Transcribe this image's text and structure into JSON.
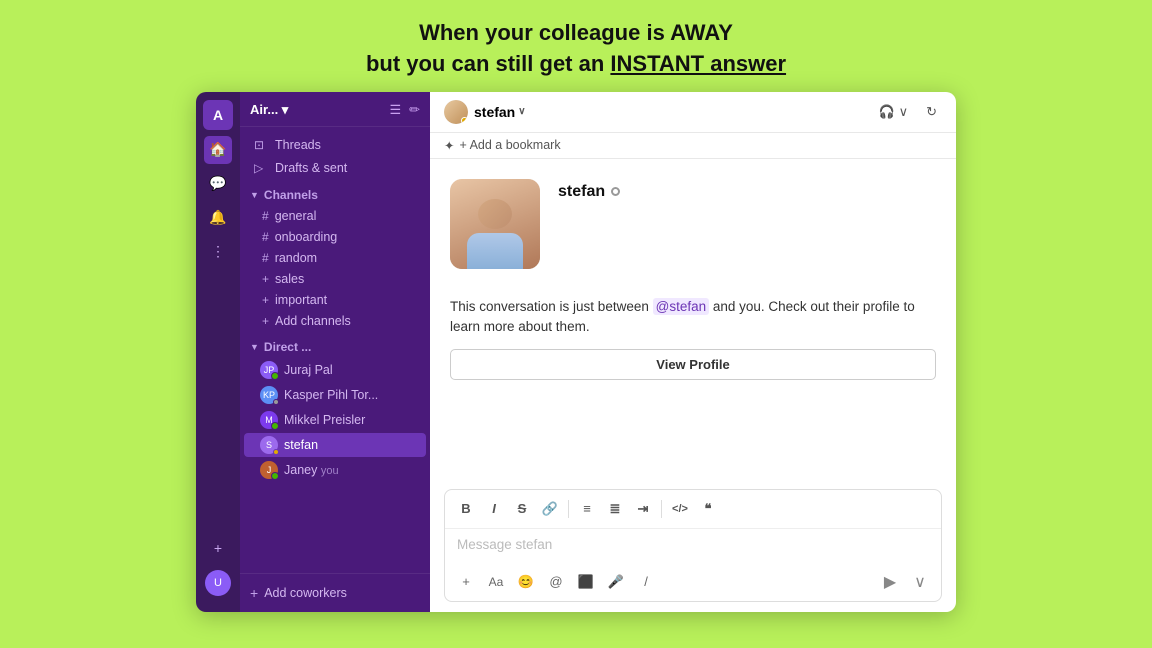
{
  "headline": {
    "line1": "When your colleague is AWAY",
    "line2": "but you can still get an ",
    "line2_highlight": "INSTANT answer"
  },
  "app": {
    "workspace": "Air... ▾",
    "logo_letter": "A"
  },
  "sidebar": {
    "nav_items": [
      {
        "id": "threads",
        "label": "Threads",
        "icon": "⊡"
      },
      {
        "id": "drafts",
        "label": "Drafts & sent",
        "icon": "▷"
      }
    ],
    "channels_label": "Channels",
    "channels": [
      {
        "id": "general",
        "name": "general"
      },
      {
        "id": "onboarding",
        "name": "onboarding"
      },
      {
        "id": "random",
        "name": "random"
      },
      {
        "id": "sales",
        "name": "sales",
        "plus": true
      },
      {
        "id": "important",
        "name": "important",
        "plus": true
      },
      {
        "id": "add",
        "name": "Add channels",
        "is_add": true
      }
    ],
    "direct_label": "Direct ...",
    "dms": [
      {
        "id": "juraj",
        "name": "Juraj Pal",
        "color": "#8b5cf6",
        "initials": "JP",
        "status": "online"
      },
      {
        "id": "kasper",
        "name": "Kasper Pihl Tor...",
        "color": "#5c8ff5",
        "initials": "KP",
        "status": "away"
      },
      {
        "id": "mikkel",
        "name": "Mikkel Preisler",
        "color": "#7c3aed",
        "initials": "MP",
        "status": "online"
      },
      {
        "id": "stefan",
        "name": "stefan",
        "color": "#9c6aed",
        "initials": "S",
        "status": "away",
        "active": true
      },
      {
        "id": "janey",
        "name": "Janey",
        "you": true,
        "color": "#c06030",
        "initials": "J",
        "status": "online"
      }
    ],
    "add_coworkers": "Add coworkers"
  },
  "main": {
    "header": {
      "name": "stefan",
      "chevron": "∨",
      "bookmark_label": "+ Add a bookmark"
    },
    "profile": {
      "name": "stefan",
      "intro_text_pre": "This conversation is just between ",
      "mention": "@stefan",
      "intro_text_post": " and you. Check out their profile to learn more about them.",
      "view_profile_btn": "View Profile"
    },
    "composer": {
      "placeholder": "Message stefan",
      "toolbar_buttons": [
        {
          "id": "bold",
          "label": "B"
        },
        {
          "id": "italic",
          "label": "I"
        },
        {
          "id": "strikethrough",
          "label": "S"
        },
        {
          "id": "link",
          "label": "🔗"
        },
        {
          "id": "ordered-list",
          "label": "≡"
        },
        {
          "id": "unordered-list",
          "label": "≣"
        },
        {
          "id": "indent",
          "label": "⇥"
        },
        {
          "id": "code",
          "label": "<>"
        },
        {
          "id": "blockquote",
          "label": "❝"
        }
      ],
      "footer_buttons": [
        {
          "id": "plus",
          "label": "+"
        },
        {
          "id": "font",
          "label": "Aa"
        },
        {
          "id": "emoji",
          "label": "😊"
        },
        {
          "id": "mention",
          "label": "@"
        },
        {
          "id": "video",
          "label": "⬜"
        },
        {
          "id": "mic",
          "label": "🎙"
        },
        {
          "id": "slash",
          "label": "/"
        }
      ]
    }
  }
}
